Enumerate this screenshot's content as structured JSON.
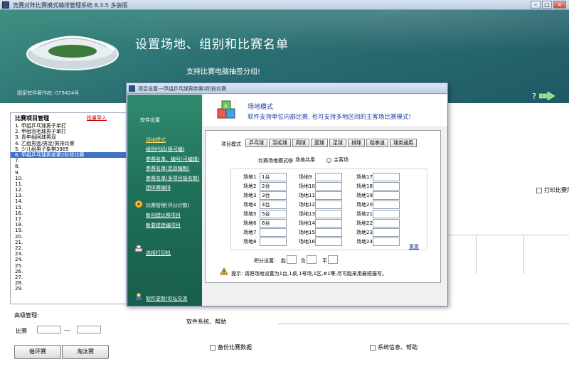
{
  "window": {
    "title": "竞赛对阵比赛模式编排管理系统 8.3.5 多装版",
    "buttons": {
      "min": "–",
      "max": "□",
      "close": "×"
    }
  },
  "banner": {
    "title": "设置场地、组别和比赛名单",
    "subtitle": "支持比赛电脑抽签分组!",
    "copyright": "国家软件著作权: 079424号",
    "help_glyph": "?"
  },
  "left_panel": {
    "header": "比赛项目管理",
    "import_link": "批量导入",
    "items": [
      "1. 甲组乒乓球男子单打",
      "2. 甲组羽毛球男子单打",
      "3. 青年组网球男双",
      "4. 乙组男篮/男足/男排比赛",
      "5. 少儿组男子象棋3985",
      "6. 甲组乒乓球男单第2阶段比赛",
      "7.",
      "8.",
      "9.",
      "10.",
      "11.",
      "12.",
      "13.",
      "14.",
      "15.",
      "16.",
      "17.",
      "18.",
      "19.",
      "20.",
      "21.",
      "22.",
      "23.",
      "24.",
      "25.",
      "26.",
      "27.",
      "28.",
      "29."
    ],
    "selected_index": 5
  },
  "advanced": {
    "label": "高级管理:",
    "match_label": "比赛",
    "dash": "---",
    "round_robin_btn": "循环赛",
    "knockout_btn": "淘汰赛"
  },
  "right_area": {
    "print_label": "打印比赛用表",
    "soft_sys": "软件系统、帮助",
    "backup": "备份比赛数据",
    "sysinfo": "系统信息、帮助"
  },
  "dialog": {
    "title": "项目设置---甲组乒乓球男单第2阶段比赛",
    "sidebar": {
      "soft_settings": "软件设置",
      "links1": [
        "场地模式",
        "组别代码(限可编)",
        "参赛名单、编号(可编辑)",
        "参赛名单(混双编制)",
        "参赛名单(多项目报名数)",
        "团体赛编排"
      ],
      "match_mgmt": "比赛管理(评分计数)",
      "links2": [
        "新创建比赛项目",
        "新要建造编项目"
      ],
      "select_print": "选择打印机",
      "forum": "软件更新/论坛交流"
    },
    "header": {
      "title": "场地模式",
      "desc": "软件支持单位内部比赛, 也可支持多地区间的主客场比赛模式!"
    },
    "project_mode_label": "项目模式",
    "project_buttons": [
      "乒乓球",
      "羽毛球",
      "网球",
      "篮球",
      "足球",
      "排球",
      "跆拳道",
      "球类通用"
    ],
    "venue_mode_label": "比赛场地模式",
    "radio_shared": "场地共用",
    "radio_home_away": "主客场",
    "venues": [
      {
        "label": "场地1",
        "value": "1台"
      },
      {
        "label": "场地2",
        "value": "2台"
      },
      {
        "label": "场地3",
        "value": "3台"
      },
      {
        "label": "场地4",
        "value": "4台"
      },
      {
        "label": "场地5",
        "value": "5台"
      },
      {
        "label": "场地6",
        "value": "6台"
      },
      {
        "label": "场地7",
        "value": ""
      },
      {
        "label": "场地8",
        "value": ""
      },
      {
        "label": "场地9",
        "value": ""
      },
      {
        "label": "场地10",
        "value": ""
      },
      {
        "label": "场地11",
        "value": ""
      },
      {
        "label": "场地12",
        "value": ""
      },
      {
        "label": "场地13",
        "value": ""
      },
      {
        "label": "场地14",
        "value": ""
      },
      {
        "label": "场地15",
        "value": ""
      },
      {
        "label": "场地16",
        "value": ""
      },
      {
        "label": "场地17",
        "value": ""
      },
      {
        "label": "场地18",
        "value": ""
      },
      {
        "label": "场地19",
        "value": ""
      },
      {
        "label": "场地20",
        "value": ""
      },
      {
        "label": "场地21",
        "value": ""
      },
      {
        "label": "场地22",
        "value": ""
      },
      {
        "label": "场地23",
        "value": ""
      },
      {
        "label": "场地24",
        "value": ""
      }
    ],
    "reset_label": "重置",
    "score_label": "积分设置:",
    "score_win": "胜",
    "score_lose": "负",
    "score_draw": "平",
    "tip": "提示: 请把场地设置为1台,1桌,1号场,1区,#1等,尽可能采用最短描写。"
  }
}
